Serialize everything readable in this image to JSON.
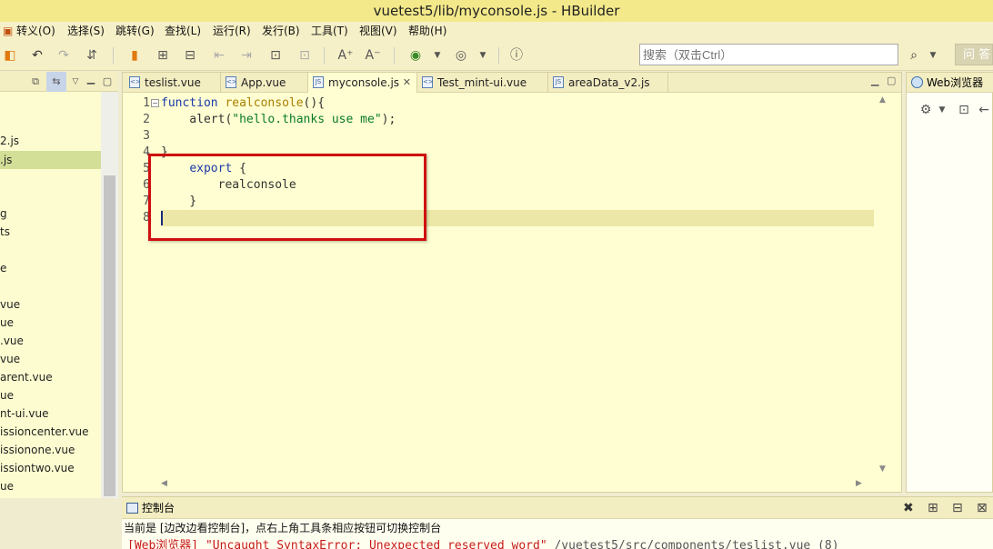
{
  "window": {
    "title": "vuetest5/lib/myconsole.js  -  HBuilder"
  },
  "menu": {
    "items": [
      "转义(O)",
      "选择(S)",
      "跳转(G)",
      "查找(L)",
      "运行(R)",
      "发行(B)",
      "工具(T)",
      "视图(V)",
      "帮助(H)"
    ]
  },
  "toolbar": {
    "search_placeholder": "搜索（双击Ctrl）",
    "ask_label": "问 答"
  },
  "explorer": {
    "items": [
      {
        "label": "2.js",
        "selected": false
      },
      {
        "label": ".js",
        "selected": true
      },
      {
        "label": "g",
        "selected": false
      },
      {
        "label": "ts",
        "selected": false
      },
      {
        "label": "e",
        "selected": false
      },
      {
        "label": "vue",
        "selected": false
      },
      {
        "label": "ue",
        "selected": false
      },
      {
        "label": ".vue",
        "selected": false
      },
      {
        "label": "vue",
        "selected": false
      },
      {
        "label": "arent.vue",
        "selected": false
      },
      {
        "label": "ue",
        "selected": false
      },
      {
        "label": "nt-ui.vue",
        "selected": false
      },
      {
        "label": "issioncenter.vue",
        "selected": false
      },
      {
        "label": "issionone.vue",
        "selected": false
      },
      {
        "label": "issiontwo.vue",
        "selected": false
      },
      {
        "label": "ue",
        "selected": false
      }
    ]
  },
  "editor": {
    "tabs": [
      {
        "label": "teslist.vue",
        "icon": "vue-file-icon",
        "active": false
      },
      {
        "label": "App.vue",
        "icon": "vue-file-icon",
        "active": false
      },
      {
        "label": "myconsole.js",
        "icon": "js-file-icon",
        "active": true
      },
      {
        "label": "Test_mint-ui.vue",
        "icon": "vue-file-icon",
        "active": false
      },
      {
        "label": "areaData_v2.js",
        "icon": "js-file-icon",
        "active": false
      }
    ],
    "line_numbers": [
      "1",
      "2",
      "3",
      "4",
      "5",
      "6",
      "7",
      "8"
    ],
    "code": {
      "l1_kw": "function",
      "l1_fn": "realconsole",
      "l1_rest": "(){",
      "l2_call": "    alert(",
      "l2_str": "\"hello.thanks use me\"",
      "l2_end": ");",
      "l4": "}",
      "l5_kw": "export",
      "l5_rest": " {",
      "l6": "        realconsole",
      "l7": "    }"
    }
  },
  "right_panel": {
    "tab_label": "Web浏览器"
  },
  "console": {
    "tab_label": "控制台",
    "hint": "当前是 [边改边看控制台]，点右上角工具条相应按钮可切换控制台",
    "error_prefix": "[Web浏览器] \"Uncaught SyntaxError: Unexpected reserved word\"",
    "error_location": "  /vuetest5/src/components/teslist.vue (8)"
  },
  "colors": {
    "title_bar": "#f3e98a",
    "editor_bg": "#fffed2",
    "current_line": "#ece7a6",
    "selected_tree_item": "#d3df97",
    "highlight_box": "#d01010",
    "error_text": "#c81a1a"
  }
}
